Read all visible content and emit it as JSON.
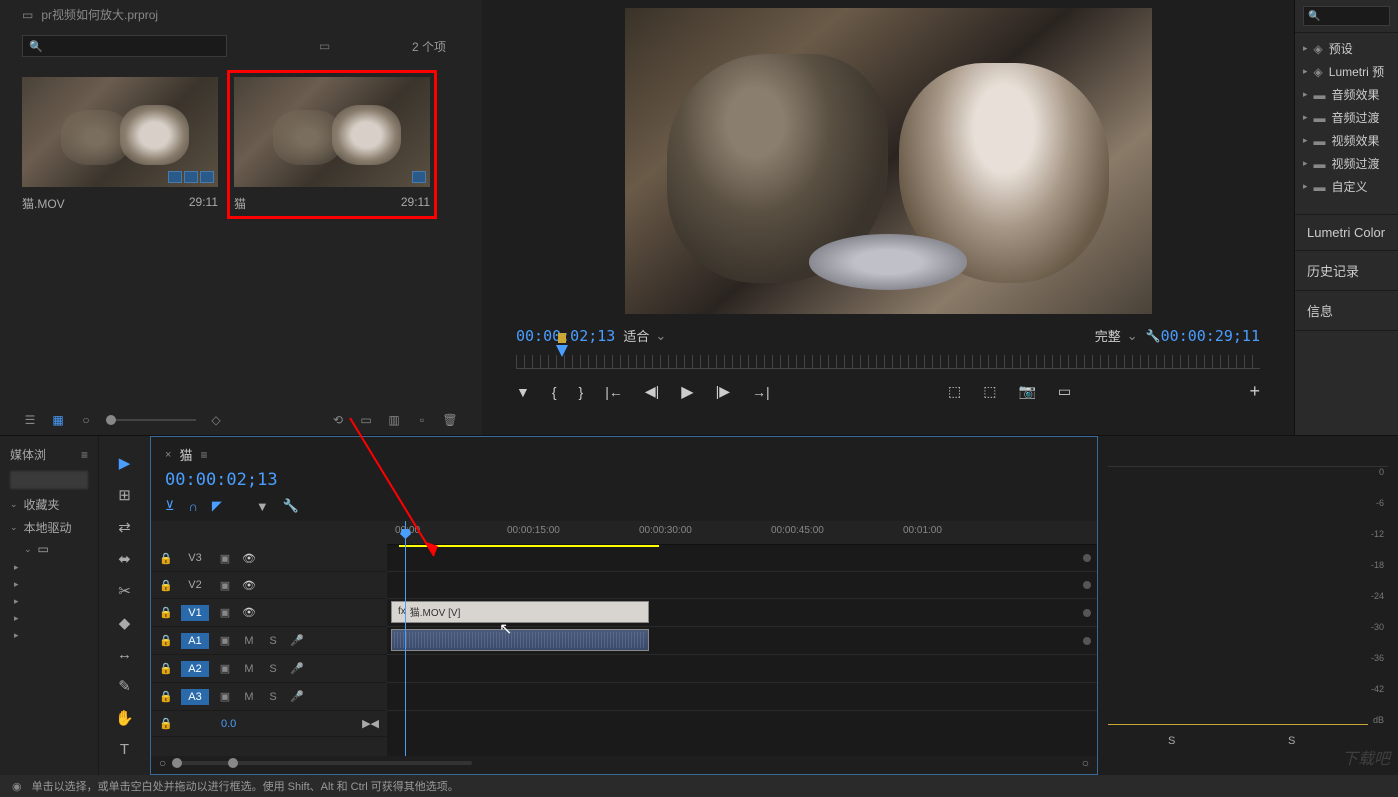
{
  "project": {
    "title": "pr视频如何放大.prproj",
    "item_count": "2 个项",
    "search_placeholder": "",
    "thumbs": [
      {
        "name": "猫.MOV",
        "duration": "29:11",
        "highlighted": false,
        "badges": 3
      },
      {
        "name": "猫",
        "duration": "29:11",
        "highlighted": true,
        "badges": 1
      }
    ]
  },
  "program": {
    "current_tc": "00:00:02;13",
    "total_tc": "00:00:29;11",
    "fit_label": "适合",
    "quality_label": "完整"
  },
  "effects": {
    "items": [
      {
        "label": "预设",
        "icon": "preset"
      },
      {
        "label": "Lumetri 预",
        "icon": "preset"
      },
      {
        "label": "音频效果",
        "icon": "folder"
      },
      {
        "label": "音频过渡",
        "icon": "folder"
      },
      {
        "label": "视频效果",
        "icon": "folder"
      },
      {
        "label": "视频过渡",
        "icon": "folder"
      },
      {
        "label": "自定义",
        "icon": "folder"
      }
    ],
    "tabs": [
      {
        "label": "Lumetri Color"
      },
      {
        "label": "历史记录"
      },
      {
        "label": "信息"
      }
    ]
  },
  "media_browser": {
    "title": "媒体浏",
    "items": [
      {
        "label": "收藏夹"
      },
      {
        "label": "本地驱动"
      }
    ]
  },
  "timeline": {
    "sequence_name": "猫",
    "timecode": "00:00:02;13",
    "ruler": [
      "00:00",
      "00:00:15:00",
      "00:00:30:00",
      "00:00:45:00",
      "00:01:00"
    ],
    "tracks": {
      "video": [
        {
          "id": "V3",
          "active": false
        },
        {
          "id": "V2",
          "active": false
        },
        {
          "id": "V1",
          "active": true
        }
      ],
      "audio": [
        {
          "id": "A1",
          "active": true
        },
        {
          "id": "A2",
          "active": true
        },
        {
          "id": "A3",
          "active": true
        }
      ],
      "master_value": "0.0"
    },
    "clip_video_label": "猫.MOV [V]"
  },
  "audio_meter": {
    "db_marks": [
      "0",
      "-6",
      "-12",
      "-18",
      "-24",
      "-30",
      "-36",
      "-42",
      "dB"
    ],
    "solo_label": "S"
  },
  "status": {
    "text": "单击以选择，或单击空白处并拖动以进行框选。使用 Shift、Alt 和 Ctrl 可获得其他选项。"
  },
  "watermark": "下载吧"
}
